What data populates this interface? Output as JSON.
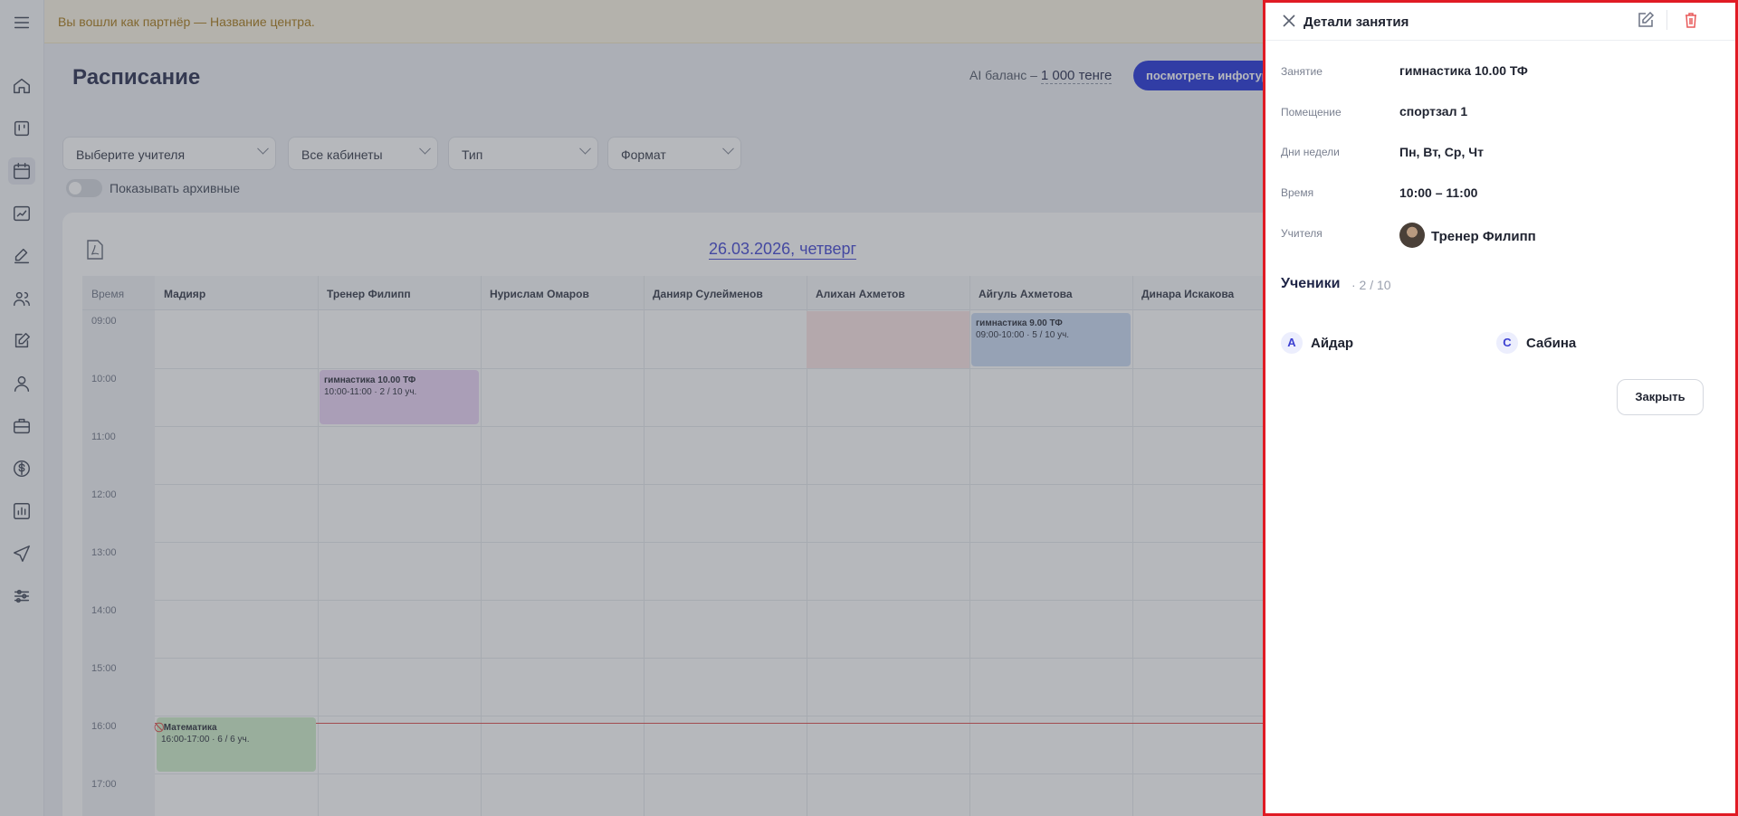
{
  "banner": {
    "text": "Вы вошли как партнёр — Название центра."
  },
  "sidebar": {
    "items": [
      {
        "icon": "menu-icon"
      },
      {
        "icon": "home-icon"
      },
      {
        "icon": "kanban-icon"
      },
      {
        "icon": "calendar-icon",
        "active": true
      },
      {
        "icon": "chart-icon"
      },
      {
        "icon": "edit-icon"
      },
      {
        "icon": "users-icon"
      },
      {
        "icon": "edit-note-icon"
      },
      {
        "icon": "user-icon"
      },
      {
        "icon": "briefcase-icon"
      },
      {
        "icon": "dollar-icon"
      },
      {
        "icon": "bar-chart-icon"
      },
      {
        "icon": "send-icon"
      },
      {
        "icon": "sliders-icon"
      }
    ]
  },
  "header": {
    "title": "Расписание",
    "ai_balance_label": "AI баланс –",
    "ai_balance_value": "1 000 тенге",
    "infotour_button": "посмотреть инфотур"
  },
  "filters": {
    "teacher": "Выберите учителя",
    "rooms": "Все кабинеты",
    "type": "Тип",
    "format": "Формат",
    "show_archived": "Показывать архивные"
  },
  "schedule": {
    "date": "26.03.2026, четверг",
    "time_header": "Время",
    "columns": [
      "Мадияр",
      "Тренер Филипп",
      "Нурислам Омаров",
      "Данияр Сулейменов",
      "Алихан Ахметов",
      "Айгуль Ахметова",
      "Динара Искакова"
    ],
    "times": [
      "09:00",
      "10:00",
      "11:00",
      "12:00",
      "13:00",
      "14:00",
      "15:00",
      "16:00",
      "17:00"
    ],
    "events": [
      {
        "title": "гимнастика 10.00 ТФ",
        "meta": "10:00-11:00 · 2 / 10 уч.",
        "color": "#ead3f7"
      },
      {
        "title": "гимнастика 9.00 ТФ",
        "meta": "09:00-10:00 · 5 / 10 уч.",
        "color": "#c9daf3"
      },
      {
        "title": "Математика",
        "meta": "16:00-17:00 · 6 / 6 уч.",
        "color": "#cdeec8"
      }
    ]
  },
  "drawer": {
    "title": "Детали занятия",
    "fields": {
      "lesson_label": "Занятие",
      "lesson_value": "гимнастика 10.00 ТФ",
      "room_label": "Помещение",
      "room_value": "спортзал 1",
      "days_label": "Дни недели",
      "days_value": "Пн, Вт, Ср, Чт",
      "time_label": "Время",
      "time_value": "10:00 – 11:00",
      "teacher_label": "Учителя",
      "teacher_value": "Тренер Филипп"
    },
    "students_title": "Ученики",
    "students_count": "· 2 / 10",
    "students": [
      {
        "initial": "А",
        "name": "Айдар"
      },
      {
        "initial": "С",
        "name": "Сабина"
      }
    ],
    "close_button": "Закрыть",
    "accent_color": "#e01b24"
  }
}
